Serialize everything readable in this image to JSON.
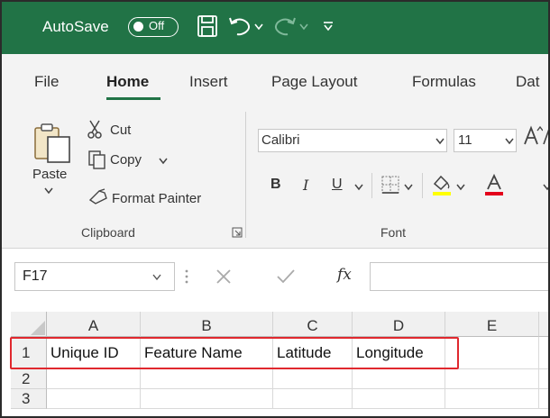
{
  "titlebar": {
    "autosave_label": "AutoSave",
    "autosave_state": "Off",
    "icons": [
      "save-icon",
      "undo-icon",
      "redo-icon",
      "customize-qat-icon"
    ],
    "color": "#217346"
  },
  "tabs": [
    {
      "label": "File"
    },
    {
      "label": "Home",
      "active": true
    },
    {
      "label": "Insert"
    },
    {
      "label": "Page Layout"
    },
    {
      "label": "Formulas"
    },
    {
      "label": "Dat"
    }
  ],
  "ribbon": {
    "clipboard": {
      "paste": "Paste",
      "cut": "Cut",
      "copy": "Copy",
      "format_painter": "Format Painter",
      "group_label": "Clipboard"
    },
    "font": {
      "font_name": "Calibri",
      "font_size": "11",
      "bold": "B",
      "italic": "I",
      "underline": "U",
      "group_label": "Font"
    }
  },
  "formula_bar": {
    "name_box": "F17",
    "fx": "fx",
    "formula": ""
  },
  "sheet": {
    "columns": [
      "A",
      "B",
      "C",
      "D",
      "E"
    ],
    "rows": [
      {
        "num": "1",
        "cells": [
          "Unique ID",
          "Feature Name",
          "Latitude",
          "Longitude",
          ""
        ]
      },
      {
        "num": "2",
        "cells": [
          "",
          "",
          "",
          "",
          ""
        ]
      },
      {
        "num": "3",
        "cells": [
          "",
          "",
          "",
          "",
          ""
        ]
      }
    ],
    "highlight_color": "#e0282e"
  }
}
